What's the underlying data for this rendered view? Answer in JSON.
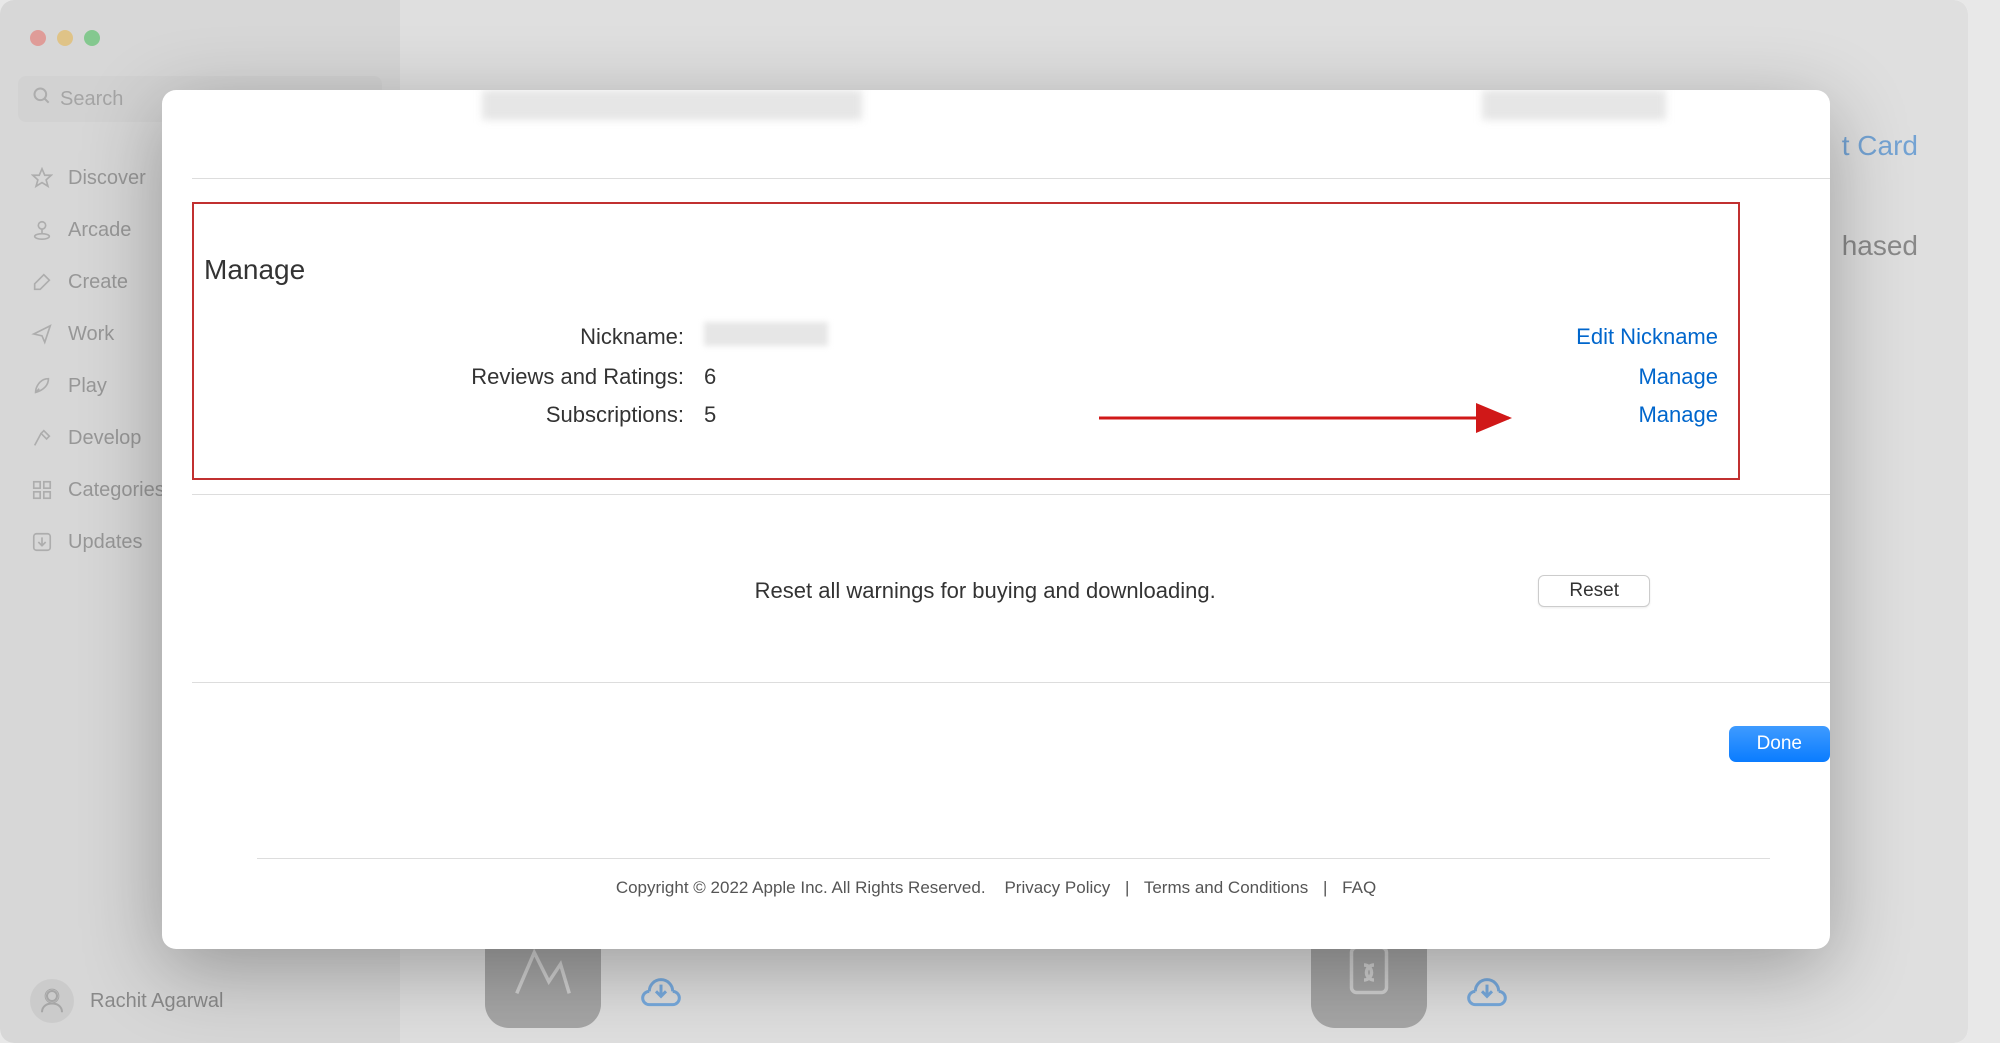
{
  "sidebar": {
    "search_placeholder": "Search",
    "items": [
      {
        "label": "Discover",
        "icon": "star"
      },
      {
        "label": "Arcade",
        "icon": "joystick"
      },
      {
        "label": "Create",
        "icon": "brush"
      },
      {
        "label": "Work",
        "icon": "paperplane"
      },
      {
        "label": "Play",
        "icon": "rocket"
      },
      {
        "label": "Develop",
        "icon": "hammer"
      },
      {
        "label": "Categories",
        "icon": "grid"
      },
      {
        "label": "Updates",
        "icon": "download-square"
      }
    ],
    "user_name": "Rachit Agarwal"
  },
  "background": {
    "top_link_fragment": "t Card",
    "right_text_fragment": "hased"
  },
  "modal": {
    "manage_title": "Manage",
    "rows": {
      "nickname_label": "Nickname:",
      "nickname_action": "Edit Nickname",
      "reviews_label": "Reviews and Ratings:",
      "reviews_value": "6",
      "reviews_action": "Manage",
      "subscriptions_label": "Subscriptions:",
      "subscriptions_value": "5",
      "subscriptions_action": "Manage"
    },
    "reset_text": "Reset all warnings for buying and downloading.",
    "reset_button": "Reset",
    "done_button": "Done",
    "footer": {
      "copyright": "Copyright © 2022 Apple Inc. All Rights Reserved.",
      "privacy": "Privacy Policy",
      "terms": "Terms and Conditions",
      "faq": "FAQ"
    }
  }
}
